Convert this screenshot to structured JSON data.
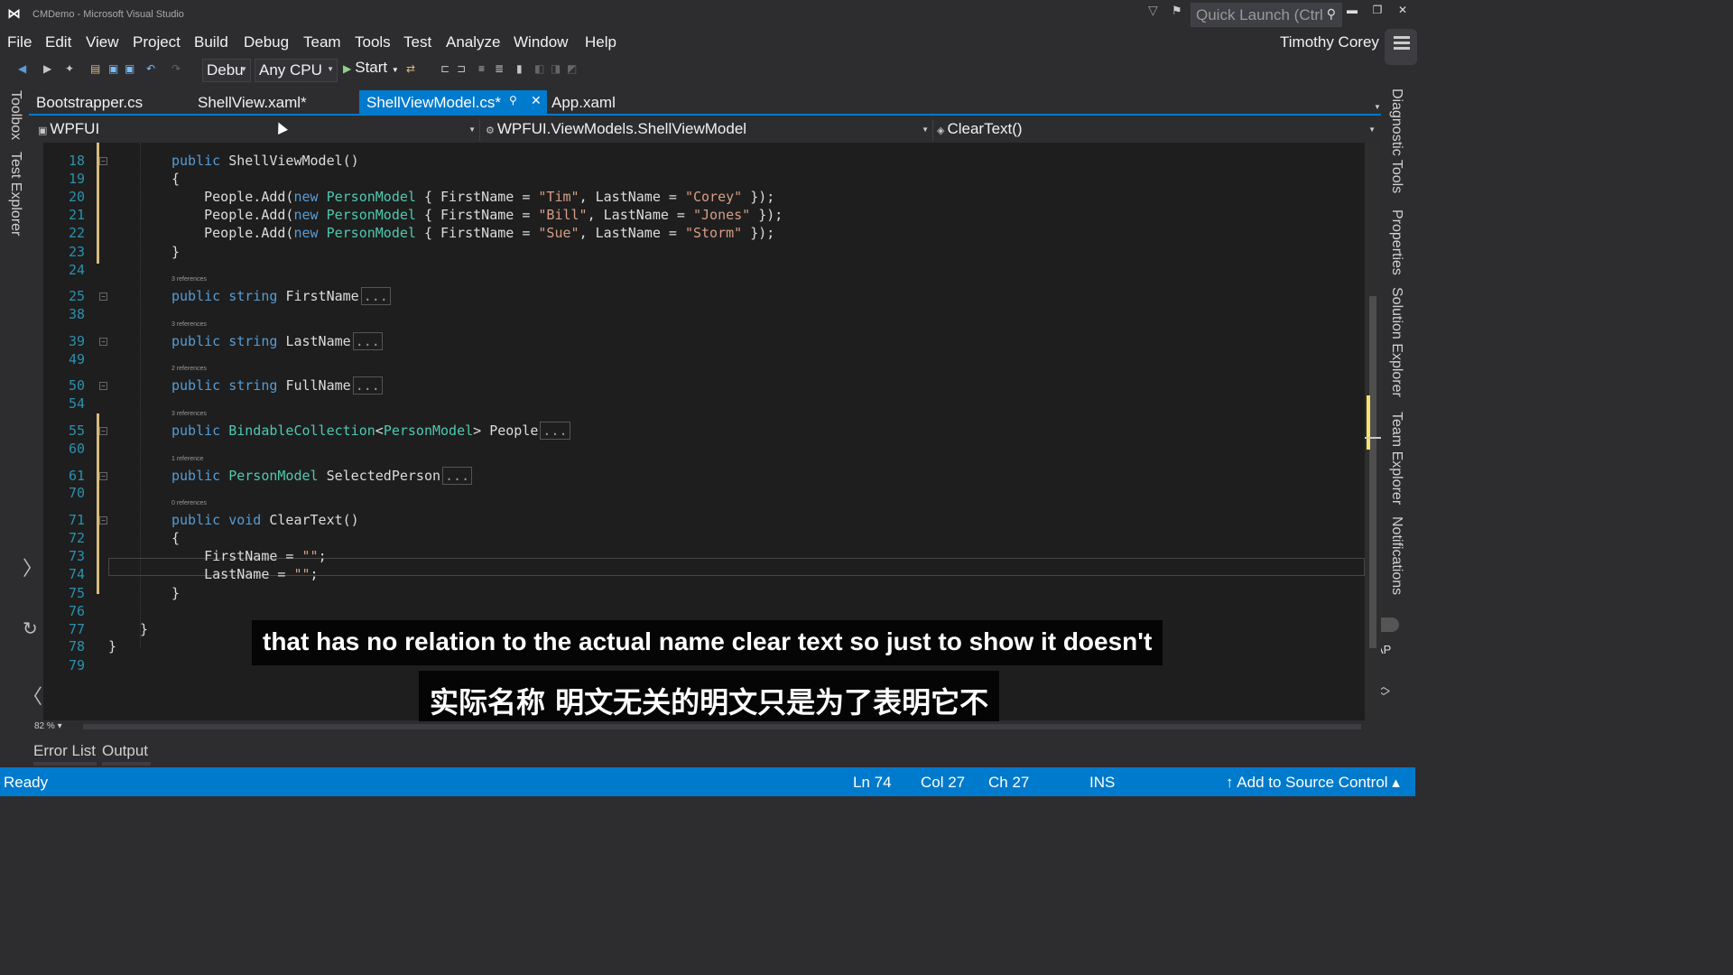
{
  "window": {
    "title": "CMDemo - Microsoft Visual Studio",
    "quick_launch_placeholder": "Quick Launch (Ctrl",
    "user": "Timothy Corey"
  },
  "menu": [
    "File",
    "Edit",
    "View",
    "Project",
    "Build",
    "Debug",
    "Team",
    "Tools",
    "Test",
    "Analyze",
    "Window",
    "Help"
  ],
  "toolbar": {
    "configuration": "Debu",
    "platform": "Any CPU",
    "start_label": "Start"
  },
  "left_rail": [
    "Toolbox",
    "Test Explorer"
  ],
  "right_rail": [
    "Diagnostic Tools",
    "Properties",
    "Solution Explorer",
    "Team Explorer",
    "Notifications"
  ],
  "tabs": [
    {
      "label": "Bootstrapper.cs",
      "active": false
    },
    {
      "label": "ShellView.xaml*",
      "active": false
    },
    {
      "label": "ShellViewModel.cs*",
      "active": true
    },
    {
      "label": "App.xaml",
      "active": false
    }
  ],
  "navbar": {
    "project": "WPFUI",
    "type": "WPFUI.ViewModels.ShellViewModel",
    "member": "ClearText()"
  },
  "code": {
    "lines": [
      {
        "num": "18",
        "lens": "",
        "parts": [
          [
            "kw",
            "public "
          ],
          [
            "",
            "ShellViewModel()"
          ]
        ]
      },
      {
        "num": "19",
        "lens": "",
        "parts": [
          [
            "",
            "{"
          ]
        ]
      },
      {
        "num": "20",
        "lens": "",
        "parts": [
          [
            "",
            "    People.Add("
          ],
          [
            "kw",
            "new "
          ],
          [
            "tp",
            "PersonModel"
          ],
          [
            "",
            " { FirstName = "
          ],
          [
            "st",
            "\"Tim\""
          ],
          [
            "",
            ", LastName = "
          ],
          [
            "st",
            "\"Corey\""
          ],
          [
            "",
            " });"
          ]
        ]
      },
      {
        "num": "21",
        "lens": "",
        "parts": [
          [
            "",
            "    People.Add("
          ],
          [
            "kw",
            "new "
          ],
          [
            "tp",
            "PersonModel"
          ],
          [
            "",
            " { FirstName = "
          ],
          [
            "st",
            "\"Bill\""
          ],
          [
            "",
            ", LastName = "
          ],
          [
            "st",
            "\"Jones\""
          ],
          [
            "",
            " });"
          ]
        ]
      },
      {
        "num": "22",
        "lens": "",
        "parts": [
          [
            "",
            "    People.Add("
          ],
          [
            "kw",
            "new "
          ],
          [
            "tp",
            "PersonModel"
          ],
          [
            "",
            " { FirstName = "
          ],
          [
            "st",
            "\"Sue\""
          ],
          [
            "",
            ", LastName = "
          ],
          [
            "st",
            "\"Storm\""
          ],
          [
            "",
            " });"
          ]
        ]
      },
      {
        "num": "23",
        "lens": "",
        "parts": [
          [
            "",
            "}"
          ]
        ]
      },
      {
        "num": "24",
        "lens": "",
        "parts": []
      },
      {
        "num": "25",
        "lens": "3 references",
        "parts": [
          [
            "kw",
            "public string "
          ],
          [
            "",
            "FirstName"
          ],
          [
            "box",
            "..."
          ]
        ]
      },
      {
        "num": "38",
        "lens": "",
        "parts": []
      },
      {
        "num": "39",
        "lens": "3 references",
        "parts": [
          [
            "kw",
            "public string "
          ],
          [
            "",
            "LastName"
          ],
          [
            "box",
            "..."
          ]
        ]
      },
      {
        "num": "49",
        "lens": "",
        "parts": []
      },
      {
        "num": "50",
        "lens": "2 references",
        "parts": [
          [
            "kw",
            "public string "
          ],
          [
            "",
            "FullName"
          ],
          [
            "box",
            "..."
          ]
        ]
      },
      {
        "num": "54",
        "lens": "",
        "parts": []
      },
      {
        "num": "55",
        "lens": "3 references",
        "parts": [
          [
            "kw",
            "public "
          ],
          [
            "tp",
            "BindableCollection"
          ],
          [
            "",
            "<"
          ],
          [
            "tp",
            "PersonModel"
          ],
          [
            "",
            "> People"
          ],
          [
            "box",
            "..."
          ]
        ]
      },
      {
        "num": "60",
        "lens": "",
        "parts": []
      },
      {
        "num": "61",
        "lens": "1 reference",
        "parts": [
          [
            "kw",
            "public "
          ],
          [
            "tp",
            "PersonModel"
          ],
          [
            "",
            " SelectedPerson"
          ],
          [
            "box",
            "..."
          ]
        ]
      },
      {
        "num": "70",
        "lens": "",
        "parts": []
      },
      {
        "num": "71",
        "lens": "0 references",
        "parts": [
          [
            "kw",
            "public void "
          ],
          [
            "",
            "ClearText()"
          ]
        ]
      },
      {
        "num": "72",
        "lens": "",
        "parts": [
          [
            "",
            "{"
          ]
        ]
      },
      {
        "num": "73",
        "lens": "",
        "parts": [
          [
            "",
            "    FirstName = "
          ],
          [
            "st",
            "\"\""
          ],
          [
            "",
            ";"
          ]
        ]
      },
      {
        "num": "74",
        "lens": "",
        "parts": [
          [
            "",
            "    LastName = "
          ],
          [
            "st",
            "\"\""
          ],
          [
            "",
            ";"
          ]
        ]
      },
      {
        "num": "75",
        "lens": "",
        "parts": [
          [
            "",
            "}"
          ]
        ]
      },
      {
        "num": "76",
        "lens": "",
        "parts": []
      },
      {
        "num": "77",
        "lens": "",
        "parts": [
          [
            "",
            "}"
          ]
        ]
      },
      {
        "num": "78",
        "lens": "",
        "parts": [
          [
            "",
            "}"
          ]
        ]
      },
      {
        "num": "79",
        "lens": "",
        "parts": []
      }
    ]
  },
  "editor": {
    "zoom": "82 %"
  },
  "bottom_tabs": [
    "Error List",
    "Output"
  ],
  "status": {
    "state": "Ready",
    "line": "Ln 74",
    "col": "Col 27",
    "ch": "Ch 27",
    "mode": "INS",
    "source_control": "↑ Add to Source Control ▴"
  },
  "side_widgets": {
    "ap_label": "AP"
  },
  "subtitles": {
    "en": "that has no relation to the actual name clear text so just to show it doesn't",
    "zh": "实际名称 明文无关的明文只是为了表明它不"
  },
  "colors": {
    "accent": "#007acc",
    "keyword": "#569cd6",
    "type": "#4ec9b0",
    "string": "#d69d85",
    "line_number": "#2b91af"
  }
}
